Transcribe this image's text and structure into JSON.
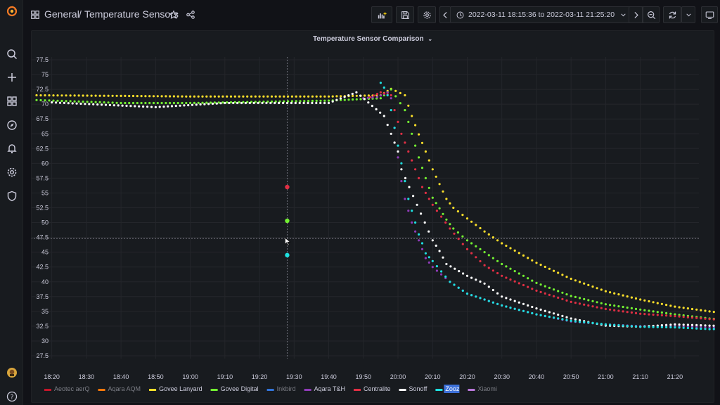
{
  "breadcrumb": {
    "folder": "General",
    "separator": "/",
    "dashboard": "Temperature Sensors"
  },
  "toolbar": {
    "time_range": "2022-03-11 18:15:36 to 2022-03-11 21:25:20"
  },
  "sidebar": {
    "items": [
      "search-icon",
      "plus-icon",
      "dashboards-icon",
      "explore-icon",
      "alerting-icon",
      "configuration-icon",
      "admin-shield-icon"
    ],
    "bottom": [
      "user-avatar",
      "help-icon"
    ]
  },
  "panel": {
    "title": "Temperature Sensor Comparison"
  },
  "colors": {
    "background": "#111217",
    "panel": "#181b1f",
    "crosshair": "#5a5d66"
  },
  "chart_data": {
    "type": "scatter",
    "title": "Temperature Sensor Comparison",
    "x_ticks": [
      "18:20",
      "18:30",
      "18:40",
      "18:50",
      "19:00",
      "19:10",
      "19:20",
      "19:30",
      "19:40",
      "19:50",
      "20:00",
      "20:10",
      "20:20",
      "20:30",
      "20:40",
      "20:50",
      "21:00",
      "21:10",
      "21:20"
    ],
    "y_ticks": [
      27.5,
      30,
      32.5,
      35,
      37.5,
      40,
      42.5,
      45,
      47.5,
      50,
      52.5,
      55,
      57.5,
      60,
      62.5,
      65,
      67.5,
      70,
      72.5,
      75,
      77.5
    ],
    "x_range_min": [
      15.6,
      205.3
    ],
    "ylim": [
      27.5,
      77.5
    ],
    "crosshair": {
      "time": "19:28",
      "value": 47.3
    },
    "series": [
      {
        "name": "Aeotec aerQ",
        "color": "#c4162a",
        "points": []
      },
      {
        "name": "Aqara AQM",
        "color": "#ff780a",
        "points": []
      },
      {
        "name": "Govee Lanyard",
        "color": "#fade2a",
        "points": [
          [
            15.6,
            71.5
          ],
          [
            40,
            71.4
          ],
          [
            60,
            71.3
          ],
          [
            80,
            71.3
          ],
          [
            100,
            71.3
          ],
          [
            115,
            71.5
          ],
          [
            118,
            72.6
          ],
          [
            122,
            71.5
          ],
          [
            124,
            68
          ],
          [
            126,
            64.9
          ],
          [
            128,
            62
          ],
          [
            130,
            59
          ],
          [
            132,
            56.5
          ],
          [
            134,
            54
          ],
          [
            136,
            52.5
          ],
          [
            140,
            50.7
          ],
          [
            145,
            48.5
          ],
          [
            150,
            46.5
          ],
          [
            160,
            43.2
          ],
          [
            170,
            40.5
          ],
          [
            180,
            38.4
          ],
          [
            190,
            37
          ],
          [
            200,
            35.8
          ],
          [
            210,
            35
          ],
          [
            220,
            34.3
          ],
          [
            230,
            33.9
          ],
          [
            240,
            33.5
          ],
          [
            250,
            33.5
          ],
          [
            260,
            33.4
          ],
          [
            270,
            33.6
          ],
          [
            280,
            34.2
          ],
          [
            290,
            34.5
          ],
          [
            295,
            34.6
          ],
          [
            300,
            34.5
          ],
          [
            305.3,
            34.6
          ]
        ]
      },
      {
        "name": "Govee Digital",
        "color": "#73f032",
        "points": [
          [
            15.6,
            70.7
          ],
          [
            40,
            70.2
          ],
          [
            60,
            70.2
          ],
          [
            80,
            70.4
          ],
          [
            100,
            70.6
          ],
          [
            115,
            71
          ],
          [
            118,
            72.5
          ],
          [
            122,
            69
          ],
          [
            124,
            65
          ],
          [
            126,
            61
          ],
          [
            128,
            57.5
          ],
          [
            130,
            54.2
          ],
          [
            132,
            52.4
          ],
          [
            134,
            50.5
          ],
          [
            136,
            49
          ],
          [
            140,
            47
          ],
          [
            145,
            45
          ],
          [
            150,
            43
          ],
          [
            160,
            39.8
          ],
          [
            170,
            37.6
          ],
          [
            180,
            36.2
          ],
          [
            190,
            35.3
          ],
          [
            200,
            34.5
          ],
          [
            210,
            33.8
          ],
          [
            220,
            33.3
          ],
          [
            230,
            32.9
          ],
          [
            240,
            32.7
          ],
          [
            245,
            32.5
          ],
          [
            250,
            33
          ],
          [
            260,
            33.2
          ],
          [
            270,
            33.5
          ],
          [
            280,
            34
          ],
          [
            290,
            34.3
          ],
          [
            300,
            34.8
          ],
          [
            305.3,
            35.2
          ]
        ]
      },
      {
        "name": "Inkbird",
        "color": "#3274d9",
        "points": []
      },
      {
        "name": "Aqara T&H",
        "color": "#8f3bb8",
        "points": [
          [
            110,
            71
          ],
          [
            114,
            71.2
          ],
          [
            117,
            72
          ],
          [
            118,
            71
          ],
          [
            119,
            66
          ],
          [
            120,
            61
          ],
          [
            121,
            57
          ],
          [
            122,
            54
          ],
          [
            124,
            50
          ],
          [
            126,
            47
          ],
          [
            128,
            44
          ],
          [
            130,
            42.5
          ],
          [
            135,
            40
          ],
          [
            140,
            38
          ],
          [
            150,
            36
          ],
          [
            160,
            34.5
          ],
          [
            170,
            33.3
          ],
          [
            180,
            32.8
          ],
          [
            190,
            32.5
          ],
          [
            200,
            32.5
          ],
          [
            210,
            32.3
          ],
          [
            220,
            32.2
          ],
          [
            230,
            32.4
          ],
          [
            240,
            32.6
          ],
          [
            250,
            32.8
          ],
          [
            260,
            33
          ],
          [
            270,
            33.4
          ],
          [
            280,
            33.8
          ],
          [
            290,
            34
          ],
          [
            300,
            34.4
          ],
          [
            305.3,
            34.6
          ]
        ]
      },
      {
        "name": "Centralite",
        "color": "#e02f44",
        "points": [
          [
            112,
            71.2
          ],
          [
            115,
            72
          ],
          [
            118,
            71.5
          ],
          [
            119,
            69
          ],
          [
            121,
            65
          ],
          [
            123,
            62
          ],
          [
            125,
            59
          ],
          [
            127,
            56
          ],
          [
            130,
            53
          ],
          [
            135,
            49
          ],
          [
            140,
            45.5
          ],
          [
            145,
            42.8
          ],
          [
            150,
            41
          ],
          [
            160,
            38.5
          ],
          [
            170,
            36.6
          ],
          [
            180,
            35.4
          ],
          [
            190,
            34.6
          ],
          [
            200,
            34.2
          ],
          [
            210,
            33.7
          ],
          [
            220,
            33.4
          ],
          [
            230,
            33.2
          ],
          [
            240,
            33
          ],
          [
            250,
            33.1
          ],
          [
            260,
            33.2
          ],
          [
            270,
            33.6
          ],
          [
            280,
            34.1
          ],
          [
            290,
            34.3
          ],
          [
            305.3,
            34.7
          ]
        ]
      },
      {
        "name": "Sonoff",
        "color": "#ffffff",
        "points": [
          [
            20,
            70.3
          ],
          [
            50,
            69.5
          ],
          [
            70,
            70.2
          ],
          [
            100,
            70.2
          ],
          [
            108,
            72
          ],
          [
            116,
            68
          ],
          [
            118,
            65
          ],
          [
            120,
            62
          ],
          [
            121,
            59
          ],
          [
            130,
            47
          ],
          [
            132,
            45.2
          ],
          [
            134,
            43
          ],
          [
            140,
            41
          ],
          [
            145,
            39.7
          ],
          [
            150,
            37.5
          ],
          [
            160,
            35.5
          ],
          [
            170,
            33.8
          ],
          [
            180,
            32.6
          ],
          [
            190,
            32.4
          ],
          [
            200,
            32.8
          ],
          [
            210,
            32.6
          ],
          [
            222,
            32.4
          ],
          [
            235,
            31.8
          ],
          [
            250,
            32.5
          ],
          [
            260,
            33
          ],
          [
            270,
            33.4
          ],
          [
            280,
            34
          ],
          [
            290,
            34.3
          ],
          [
            303,
            34.6
          ]
        ]
      },
      {
        "name": "Zooz",
        "color": "#1ee0e0",
        "points": [
          [
            115,
            73.6
          ],
          [
            116,
            72.8
          ],
          [
            117,
            71.5
          ],
          [
            118,
            69
          ],
          [
            119,
            66
          ],
          [
            120,
            63
          ],
          [
            121,
            60
          ],
          [
            122,
            57
          ],
          [
            123,
            54
          ],
          [
            124,
            52
          ],
          [
            125,
            50
          ],
          [
            126,
            48
          ],
          [
            127,
            46.5
          ],
          [
            128,
            44.8
          ],
          [
            130,
            43.5
          ],
          [
            135,
            40
          ],
          [
            140,
            38
          ],
          [
            150,
            36
          ],
          [
            160,
            34.5
          ],
          [
            170,
            33.4
          ],
          [
            180,
            32.8
          ],
          [
            190,
            32.4
          ],
          [
            200,
            32.3
          ],
          [
            210,
            32
          ],
          [
            220,
            32.1
          ],
          [
            230,
            32.3
          ],
          [
            240,
            32.5
          ],
          [
            250,
            32.7
          ],
          [
            260,
            33
          ],
          [
            270,
            33.4
          ],
          [
            280,
            33.8
          ],
          [
            290,
            34.3
          ],
          [
            300,
            34.8
          ],
          [
            305.3,
            35
          ]
        ]
      },
      {
        "name": "Xiaomi",
        "color": "#b877d9",
        "points": []
      }
    ],
    "legend_placement": "bottom-left",
    "grid": true
  },
  "legend": [
    "Aeotec aerQ",
    "Aqara AQM",
    "Govee Lanyard",
    "Govee Digital",
    "Inkbird",
    "Aqara T&H",
    "Centralite",
    "Sonoff",
    "Zooz",
    "Xiaomi"
  ]
}
